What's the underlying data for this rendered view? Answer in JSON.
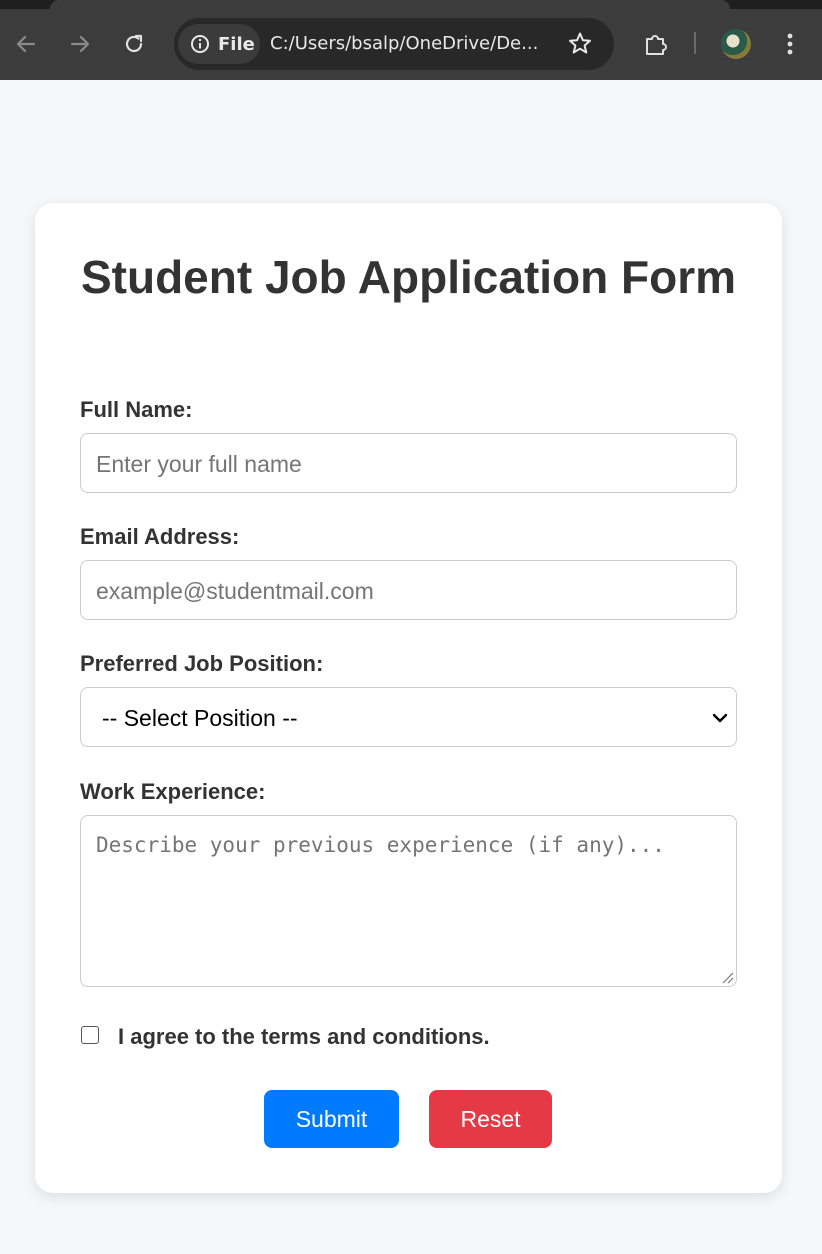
{
  "browser": {
    "address": "C:/Users/bsalp/OneDrive/De...",
    "chip_label": "File"
  },
  "form": {
    "title": "Student Job Application Form",
    "full_name": {
      "label": "Full Name:",
      "placeholder": "Enter your full name"
    },
    "email": {
      "label": "Email Address:",
      "placeholder": "example@studentmail.com"
    },
    "position": {
      "label": "Preferred Job Position:",
      "selected": "-- Select Position --"
    },
    "experience": {
      "label": "Work Experience:",
      "placeholder": "Describe your previous experience (if any)..."
    },
    "terms_label": "I agree to the terms and conditions.",
    "terms_checked": false,
    "submit_label": "Submit",
    "reset_label": "Reset"
  },
  "colors": {
    "submit": "#007bff",
    "reset": "#e63946",
    "page_bg": "#f6f7f9",
    "text": "#333333"
  }
}
